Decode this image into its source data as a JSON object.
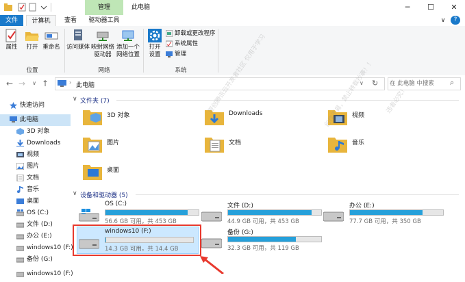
{
  "title_bar": {
    "manage_tab": "管理",
    "window_title": "此电脑",
    "minimize": "─",
    "maximize": "☐",
    "close": "✕"
  },
  "menu": {
    "file": "文件",
    "computer": "计算机",
    "view": "查看",
    "drive_tools": "驱动器工具",
    "collapse": "∨",
    "help": "?"
  },
  "ribbon": {
    "properties": "属性",
    "open": "打开",
    "rename": "重命名",
    "access_media": "访问媒体",
    "map_drive_1": "映射网络",
    "map_drive_2": "驱动器",
    "add_location_1": "添加一个",
    "add_location_2": "网络位置",
    "open_settings_1": "打开",
    "open_settings_2": "设置",
    "uninstall": "卸载或更改程序",
    "system_properties": "系统属性",
    "manage": "管理",
    "group_location": "位置",
    "group_network": "网络",
    "group_system": "系统"
  },
  "address": {
    "back": "←",
    "forward": "→",
    "recent": "∨",
    "up": "↑",
    "path": "此电脑",
    "dropdown": "∨",
    "refresh": "↻",
    "search_placeholder": "在 此电脑 中搜索",
    "search_icon": "⌕"
  },
  "nav": {
    "quick_access": "快速访问",
    "this_pc": "此电脑",
    "objects3d": "3D 对象",
    "downloads": "Downloads",
    "videos": "视频",
    "pictures": "图片",
    "documents": "文档",
    "music": "音乐",
    "desktop": "桌面",
    "os_c": "OS (C:)",
    "file_d": "文件 (D:)",
    "office_e": "办公 (E:)",
    "windows10_f": "windows10 (F:)",
    "backup_g": "备份 (G:)",
    "cut_item": "windows10 (F:)"
  },
  "content": {
    "folders_header": "文件夹 (7)",
    "drives_header": "设备和驱动器 (5)",
    "folders": [
      "3D 对象",
      "Downloads",
      "视频",
      "图片",
      "文档",
      "音乐",
      "桌面"
    ],
    "drives": [
      {
        "name": "OS (C:)",
        "info": "56.6 GB 可用，共 453 GB",
        "used_fraction": 0.88
      },
      {
        "name": "文件 (D:)",
        "info": "44.9 GB 可用，共 453 GB",
        "used_fraction": 0.9
      },
      {
        "name": "办公 (E:)",
        "info": "77.7 GB 可用，共 350 GB",
        "used_fraction": 0.78
      },
      {
        "name": "windows10 (F:)",
        "info": "14.3 GB 可用，共 14.4 GB",
        "used_fraction": 0.01
      },
      {
        "name": "备份 (G:)",
        "info": "32.3 GB 可用，共 119 GB",
        "used_fraction": 0.73
      }
    ]
  },
  "colors": {
    "accent": "#1979ca",
    "manage_tab": "#bfe6b6",
    "selection": "#cce8ff",
    "drive_bar": "#26a0da",
    "highlight": "#e8392e"
  },
  "watermark": {
    "line1": "原创腾讯云开发者社区 仅用于学习",
    "line2": "创作不易，禁止转载抄袭！！",
    "line3": "违者必究！！"
  }
}
